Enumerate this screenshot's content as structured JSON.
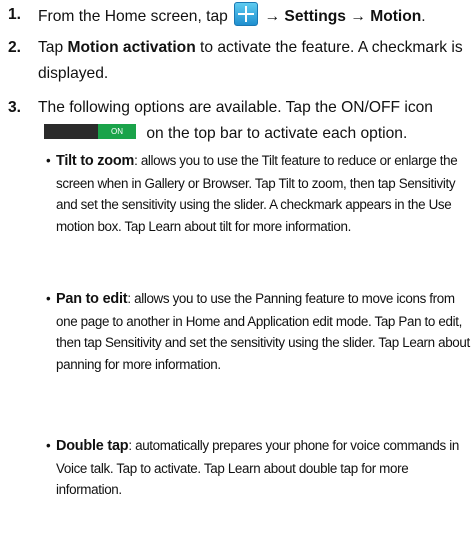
{
  "steps": [
    {
      "number": "1.",
      "text_a": "From the Home screen, tap",
      "text_b": "→ Settings → Motion",
      "text_c": "."
    },
    {
      "number": "2.",
      "text_a": "Tap",
      "bold": "Motion activation",
      "text_b": " to activate the feature. A checkmark is displayed."
    },
    {
      "number": "3.",
      "text_a": "The following options are available. Tap the ON/OFF icon",
      "text_b": "on the top bar to activate each option.",
      "toggle_label": "ON"
    }
  ],
  "bullets": [
    {
      "title": "Tilt to zoom",
      "text": ": allows you to use the Tilt feature to reduce or enlarge the screen when in Gallery or Browser. Tap Tilt to zoom, then tap Sensitivity and set the sensitivity using the slider. A checkmark appears in the Use motion box. Tap Learn about tilt for more information."
    },
    {
      "title": "Pan to edit",
      "text": ": allows you to use the Panning feature to move icons from one page to another in Home and Application edit mode. Tap Pan to edit, then tap Sensitivity and set the sensitivity using the slider. Tap Learn about panning for more information."
    },
    {
      "title": "Double tap",
      "text": ": automatically prepares your phone for voice commands in Voice talk. Tap to activate. Tap Learn about double tap for more information."
    }
  ],
  "colors": {
    "toggle_on": "#1aa34a",
    "toggle_off": "#2b2b2b",
    "apps_icon": "#1f8fcf"
  },
  "icons": {
    "apps": "apps-grid-icon",
    "toggle": "on-off-toggle-icon"
  }
}
